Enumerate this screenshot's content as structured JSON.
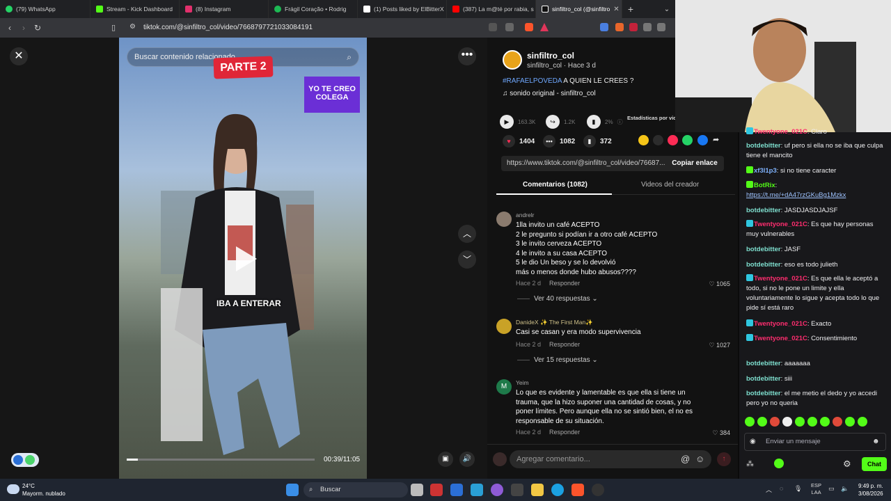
{
  "browser": {
    "tabs": [
      {
        "label": "(79) WhatsApp",
        "color": "#25d366"
      },
      {
        "label": "Stream - Kick Dashboard",
        "color": "#53fc18"
      },
      {
        "label": "(8) Instagram",
        "color": "#e1306c"
      },
      {
        "label": "Frágil Coração • Rodrig",
        "color": "#1db954"
      },
      {
        "label": "(1) Posts liked by ElBitterX",
        "color": "#ffffff"
      },
      {
        "label": "(387) La m@té por rabia, s",
        "color": "#ff0000"
      },
      {
        "label": "sinfiltro_col (@sinfiltro",
        "color": "#ffffff"
      }
    ],
    "url": "tiktok.com/@sinfiltro_col/video/7668797721033084191"
  },
  "video": {
    "search_placeholder": "Buscar contenido relacionado",
    "sticker_parte": "PARTE 2",
    "sticker_yote": "YO TE CREO COLEGA",
    "caption": "IBA A ENTERAR",
    "time": "00:39/11:05",
    "progress": 0.06
  },
  "post": {
    "username": "sinfiltro_col",
    "sub": "sinfiltro_col · Hace 3 d",
    "hashtag": "#RAFAELPOVEDA",
    "description": " A QUIEN LE CREES ?",
    "sound": "sonido original - sinfiltro_col",
    "stats": {
      "plays": "163.3K",
      "shares": "1.2K",
      "pct": "2%",
      "stats_label": "Estadísticas por vid"
    },
    "likes": "1404",
    "comments": "1082",
    "saves": "372",
    "link": "https://www.tiktok.com/@sinfiltro_col/video/76687...",
    "copy_label": "Copiar enlace",
    "tab_comments": "Comentarios (1082)",
    "tab_creator": "Videos del creador"
  },
  "comments": [
    {
      "name": "andrelr",
      "text": "1lla invito un café ACEPTO\n2 le pregunto si podían ir a otro café ACEPTO\n3 le invito cerveza ACEPTO\n4 le invito a su casa ACEPTO\n5 le dio Un beso y se lo devolvió\nmás o menos donde hubo abusos????",
      "time": "Hace 2 d",
      "reply": "Responder",
      "likes": "1065",
      "more": "Ver 40 respuestas",
      "avatar": "#8a7b6e"
    },
    {
      "name": "DanideX ✨ The First Man✨",
      "text": "Casi se casan y era modo supervivencia",
      "time": "Hace 2 d",
      "reply": "Responder",
      "likes": "1027",
      "more": "Ver 15 respuestas",
      "avatar": "#c9a227"
    },
    {
      "name": "Yeim",
      "text": "Lo que es evidente y lamentable es que ella si tiene un trauma, que la hizo suponer una cantidad de cosas, y no poner límites. Pero aunque ella no se sintió bien, el no es responsable de su situación.",
      "time": "Hace 2 d",
      "reply": "Responder",
      "likes": "384",
      "avatar": "#1e7a4a",
      "initial": "M"
    }
  ],
  "add_comment_placeholder": "Agregar comentario...",
  "chat": {
    "messages": [
      {
        "user": "Twentyone_021C",
        "color": "#ff2d6f",
        "text": ": Claro"
      },
      {
        "user": "botdebitter",
        "color": "#7fe0d0",
        "text": ": uf pero si ella no se iba que culpa tiene el mancito"
      },
      {
        "user": "xf3l1p3",
        "color": "#7fb3ff",
        "text": ": si no tiene caracter"
      },
      {
        "user": "BotRix",
        "color": "#53fc18",
        "text": ":"
      },
      {
        "user": "",
        "color": "#9ec3ff",
        "text": "https://t.me/+dA47rzGKuBg1Mzkx"
      },
      {
        "user": "botdebitter",
        "color": "#7fe0d0",
        "text": ": JASDJASDJAJSF"
      },
      {
        "user": "Twentyone_021C",
        "color": "#ff2d6f",
        "text": ": Es que hay personas muy vulnerables"
      },
      {
        "user": "botdebitter",
        "color": "#7fe0d0",
        "text": ": JASF"
      },
      {
        "user": "botdebitter",
        "color": "#7fe0d0",
        "text": ": eso es todo julieth"
      },
      {
        "user": "Twentyone_021C",
        "color": "#ff2d6f",
        "text": ": Es que ella le aceptó a todo, si no le pone un limite y ella voluntariamente lo sigue y acepta todo lo que pide sí está raro"
      },
      {
        "user": "Twentyone_021C",
        "color": "#ff2d6f",
        "text": ": Exacto"
      },
      {
        "user": "Twentyone_021C",
        "color": "#ff2d6f",
        "text": ": Consentimiento"
      },
      {
        "user": "botdebitter",
        "color": "#7fe0d0",
        "text": ": aaaaaaa"
      },
      {
        "user": "botdebitter",
        "color": "#7fe0d0",
        "text": ": siii"
      },
      {
        "user": "botdebitter",
        "color": "#7fe0d0",
        "text": ": el me metio el dedo y yo accedi pero yo no queria"
      }
    ],
    "input_placeholder": "Enviar un mensaje",
    "send_label": "Chat"
  },
  "taskbar": {
    "weather_temp": "24°C",
    "weather_desc": "Mayorm. nublado",
    "search": "Buscar",
    "lang1": "ESP",
    "lang2": "LAA",
    "time": "9:49 p. m.",
    "date": "3/08/2026"
  }
}
